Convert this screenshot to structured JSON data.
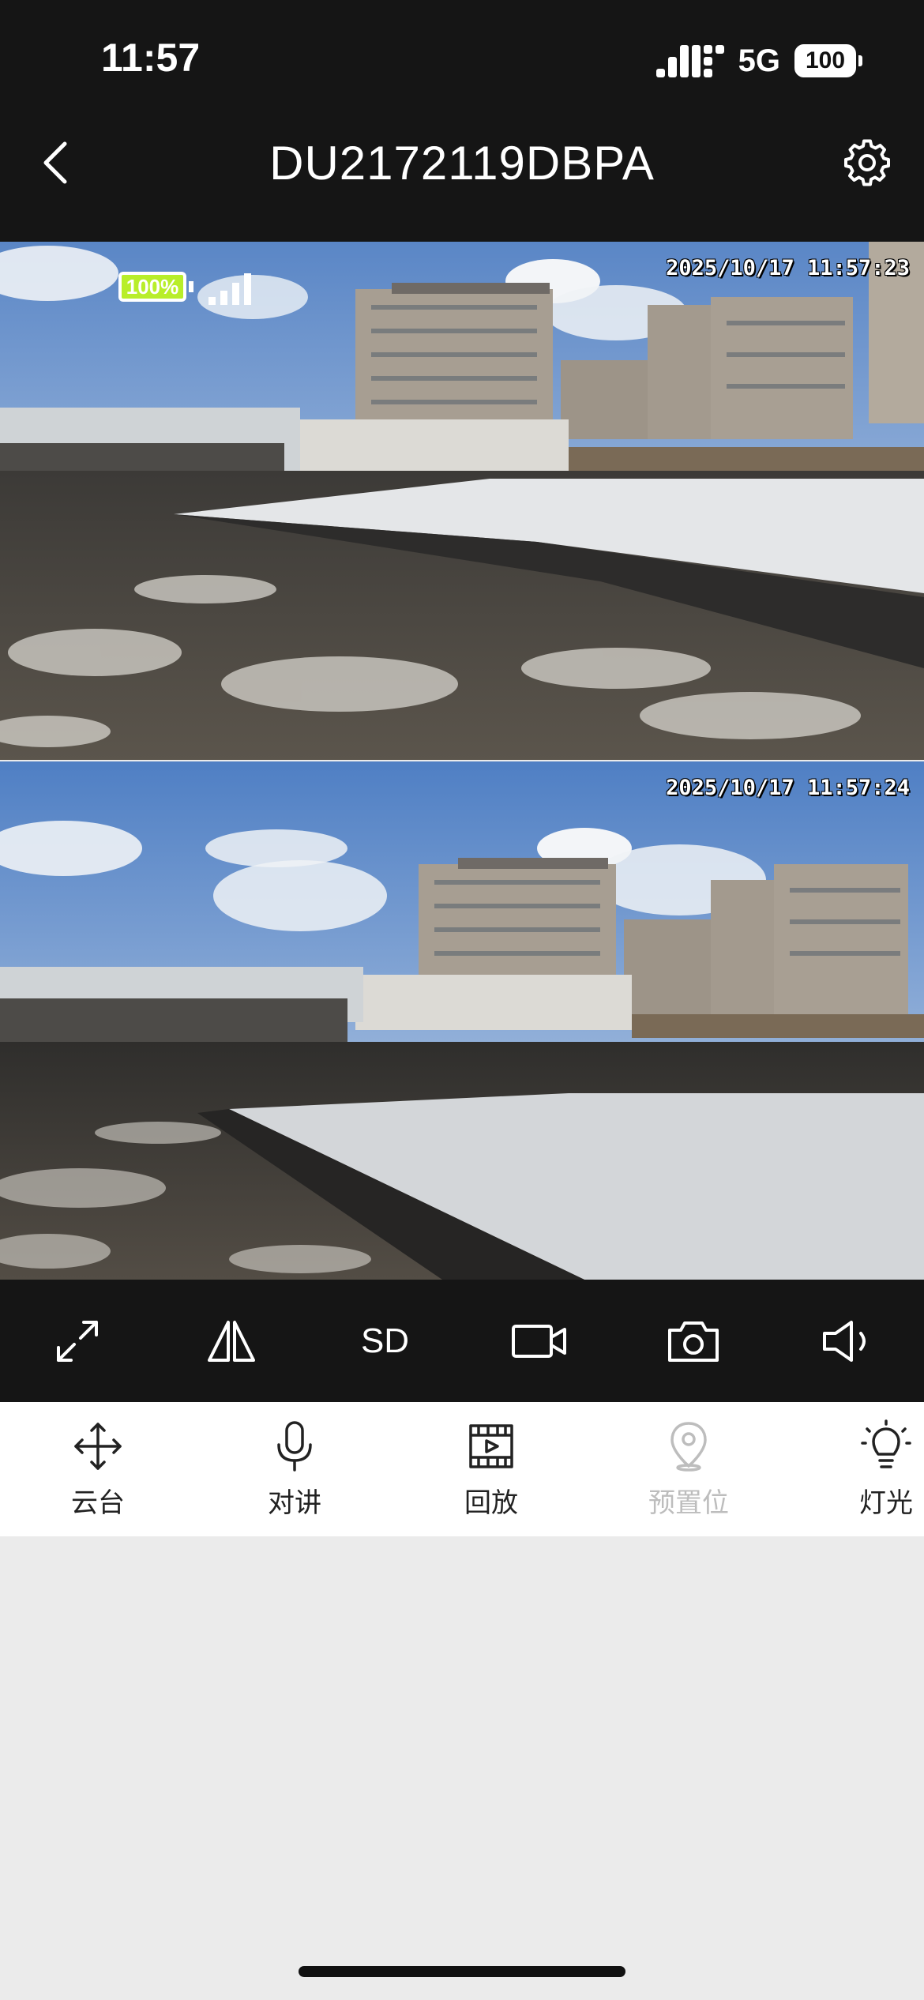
{
  "status_bar": {
    "time": "11:57",
    "network": "5G",
    "battery": "100"
  },
  "header": {
    "title": "DU2172119DBPA",
    "back_icon": "chevron-left-icon",
    "settings_icon": "gear-icon"
  },
  "feeds": [
    {
      "timestamp": "2025/10/17 11:57:23",
      "battery_percent": "100%",
      "signal_bars": 4
    },
    {
      "timestamp": "2025/10/17 11:57:24"
    }
  ],
  "toolbar": {
    "fullscreen_icon": "fullscreen-expand-icon",
    "mirror_icon": "mirror-flip-icon",
    "quality_label": "SD",
    "record_icon": "video-record-icon",
    "snapshot_icon": "camera-snapshot-icon",
    "audio_icon": "speaker-icon"
  },
  "functions": [
    {
      "label": "云台",
      "icon": "ptz-move-icon",
      "enabled": true
    },
    {
      "label": "对讲",
      "icon": "microphone-icon",
      "enabled": true
    },
    {
      "label": "回放",
      "icon": "film-playback-icon",
      "enabled": true
    },
    {
      "label": "预置位",
      "icon": "location-pin-icon",
      "enabled": false
    },
    {
      "label": "灯光",
      "icon": "light-bulb-icon",
      "enabled": true
    }
  ],
  "colors": {
    "chrome_dark": "#151515",
    "page_bg": "#ebebeb",
    "disabled_text": "#bdbdbd",
    "cam_battery_fill": "#b8ee2a"
  }
}
